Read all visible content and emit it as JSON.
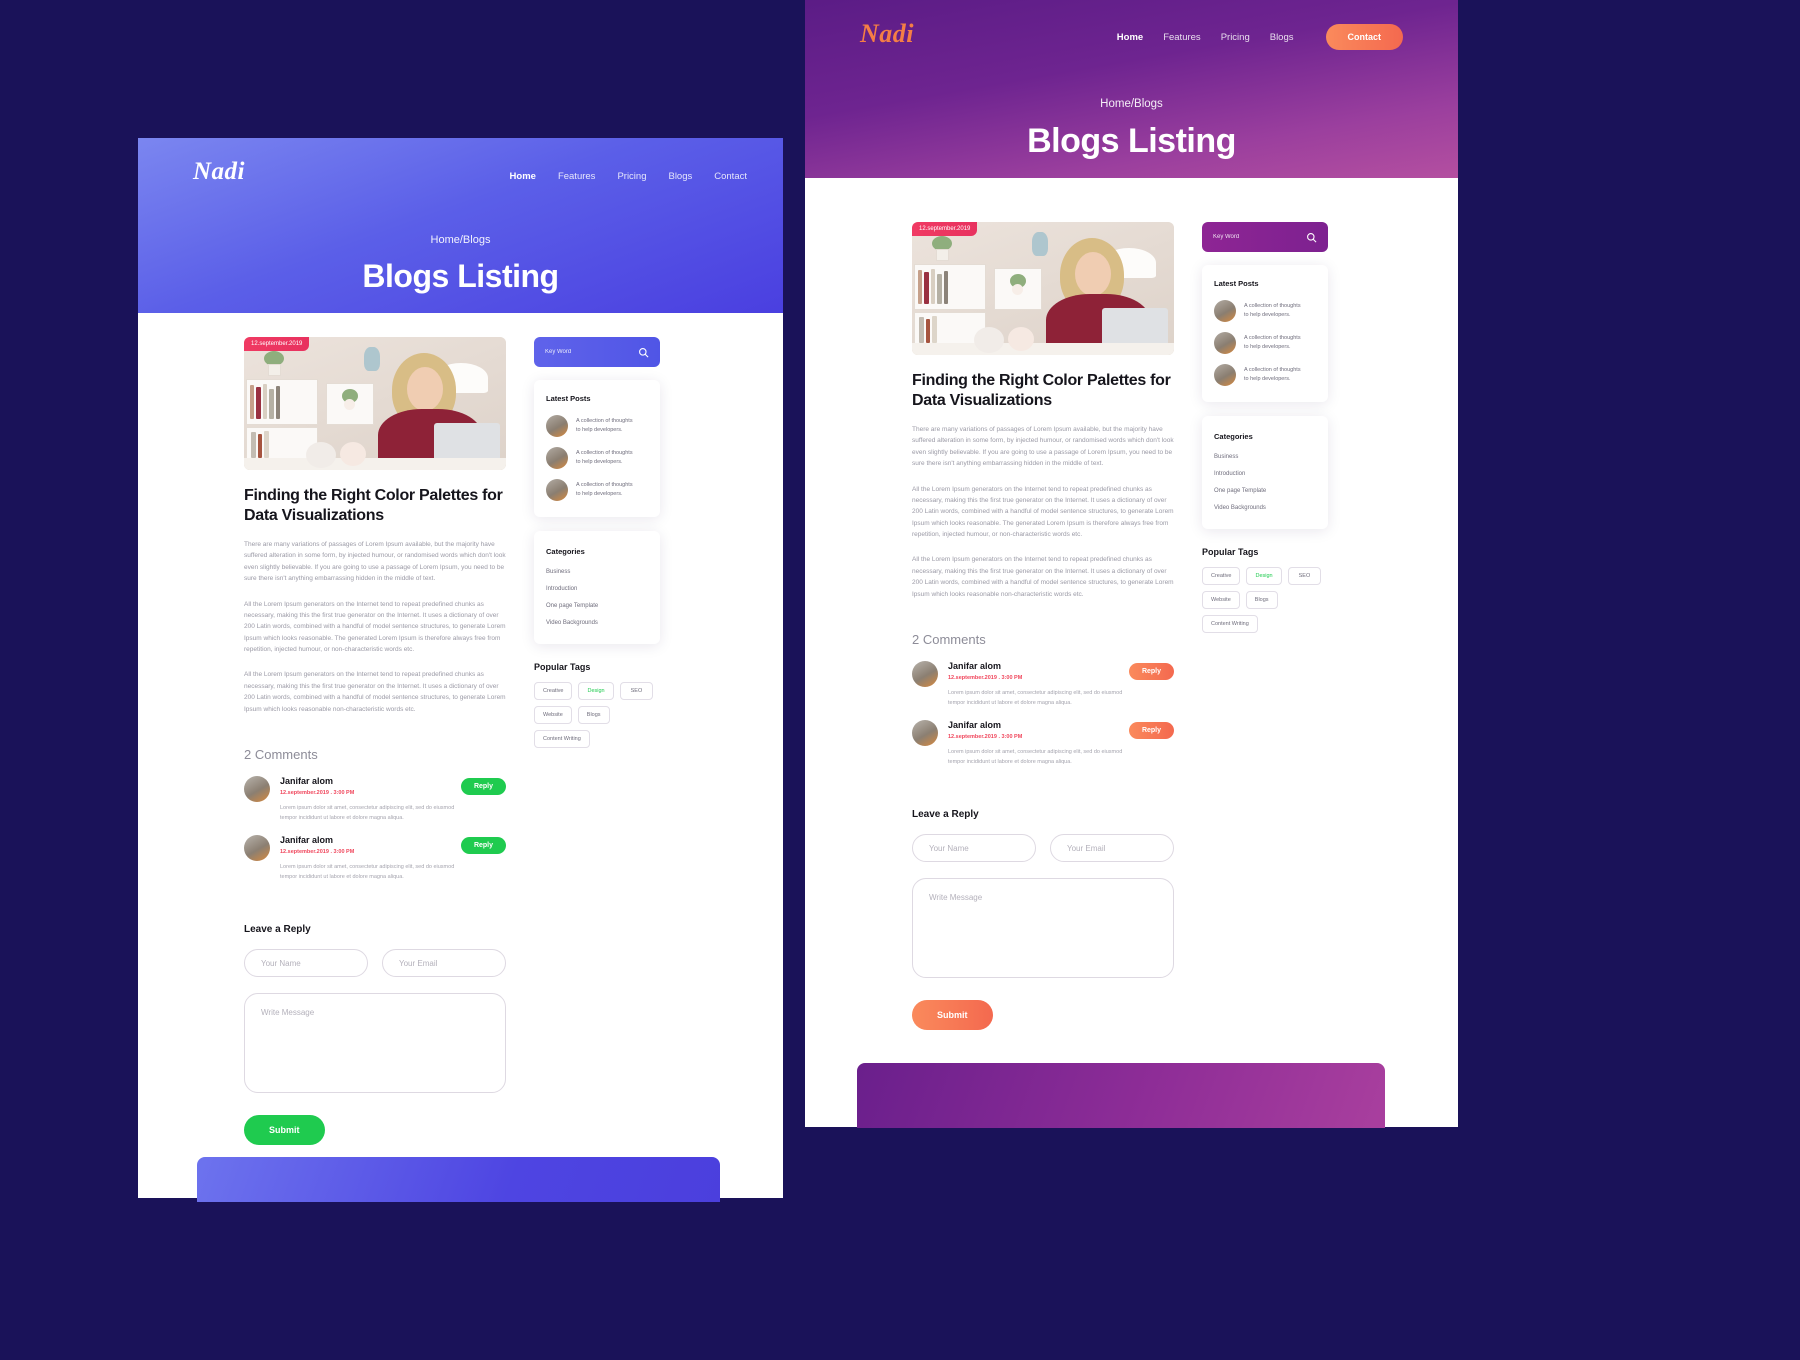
{
  "brand": {
    "logo_text": "Nadi"
  },
  "nav": {
    "items": [
      "Home",
      "Features",
      "Pricing",
      "Blogs",
      "Contact"
    ],
    "items_right": [
      "Home",
      "Features",
      "Pricing",
      "Blogs"
    ],
    "contact_label": "Contact"
  },
  "hero": {
    "breadcrumb": "Home/Blogs",
    "title": "Blogs Listing"
  },
  "post": {
    "date_badge": "12.september.2019",
    "title_line1": "Finding the Right Color Palettes for",
    "title_line2": "Data Visualizations",
    "title_full": "Finding the Right Color Palettes for Data Visualizations",
    "paragraph1": "There are many variations of passages of Lorem Ipsum available, but the majority have suffered alteration in some form, by injected humour, or randomised words which don't look even slightly believable. If you are going to use a passage of Lorem Ipsum, you need to be sure there isn't anything embarrassing hidden in the middle of text.",
    "paragraph2": "All the Lorem Ipsum generators on the Internet tend to repeat predefined chunks as necessary, making this the first true generator on the Internet. It uses a dictionary of over 200 Latin words, combined with a handful of model sentence structures, to generate Lorem Ipsum which looks reasonable. The generated Lorem Ipsum is therefore always free from repetition, injected humour, or non-characteristic words etc.",
    "paragraph3": "All the Lorem Ipsum generators on the Internet tend to repeat predefined chunks as necessary, making this the first true generator on the Internet. It uses a dictionary of over 200 Latin words, combined with a handful of model sentence structures, to generate Lorem Ipsum which looks reasonable non-characteristic words etc."
  },
  "comments": {
    "heading": "2 Comments",
    "reply_label": "Reply",
    "list": [
      {
        "name": "Janifar alom",
        "date": "12.september.2019 .  3:00 PM",
        "body": "Lorem ipsum dolor sit amet, consectetur adipiscing elit, sed do eiusmod tempor incididunt ut labore et dolore magna aliqua."
      },
      {
        "name": "Janifar alom",
        "date": "12.september.2019 .  3:00 PM",
        "body": "Lorem ipsum dolor sit amet, consectetur adipiscing elit, sed do eiusmod tempor incididunt ut labore et dolore magna aliqua."
      }
    ]
  },
  "reply_form": {
    "heading": "Leave  a Reply",
    "name_placeholder": "Your Name",
    "email_placeholder": "Your Email",
    "message_placeholder": "Write Message",
    "submit_label": "Submit"
  },
  "sidebar": {
    "search_placeholder": "Key Word",
    "search_icon": "search-icon",
    "latest_posts_title": "Latest Posts",
    "latest_posts": [
      {
        "line1": "A collection of thoughts",
        "line2": "to help developers."
      },
      {
        "line1": "A collection of thoughts",
        "line2": "to help developers."
      },
      {
        "line1": "A collection of thoughts",
        "line2": "to help developers."
      }
    ],
    "categories_title": "Categories",
    "categories": [
      "Business",
      "Introduction",
      "One page Template",
      "Video Backgrounds"
    ],
    "tags_title": "Popular Tags",
    "tags": [
      "Creative",
      "Design",
      "SEO",
      "Website",
      "Blogs",
      "Content Writing"
    ],
    "tag_accent_index": 1
  },
  "colors": {
    "page_background": "#1a1259",
    "left_hero_start": "#7b86f0",
    "left_hero_end": "#4a3fe0",
    "right_hero_start": "#5b1c86",
    "right_hero_end": "#b44fa0",
    "logo_orange": "#f57e45",
    "badge_red": "#f03a63",
    "reply_green": "#1fcb4f",
    "reply_orange": "#f4694f",
    "comment_date_red": "#f0465c",
    "search_blue": "#5b5fe8",
    "search_purple": "#8e2594"
  }
}
